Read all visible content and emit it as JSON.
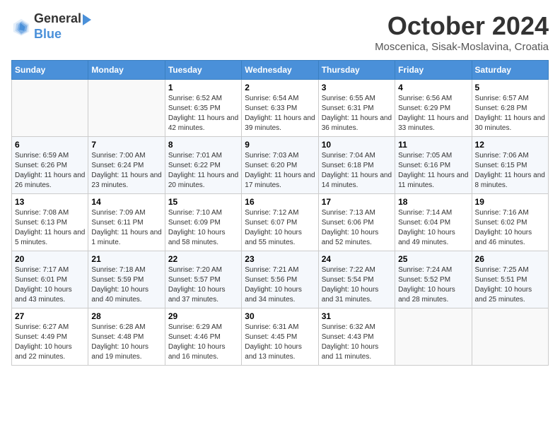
{
  "header": {
    "logo_general": "General",
    "logo_blue": "Blue",
    "title": "October 2024",
    "location": "Moscenica, Sisak-Moslavina, Croatia"
  },
  "days_of_week": [
    "Sunday",
    "Monday",
    "Tuesday",
    "Wednesday",
    "Thursday",
    "Friday",
    "Saturday"
  ],
  "weeks": [
    [
      {
        "day": "",
        "info": ""
      },
      {
        "day": "",
        "info": ""
      },
      {
        "day": "1",
        "info": "Sunrise: 6:52 AM\nSunset: 6:35 PM\nDaylight: 11 hours and 42 minutes."
      },
      {
        "day": "2",
        "info": "Sunrise: 6:54 AM\nSunset: 6:33 PM\nDaylight: 11 hours and 39 minutes."
      },
      {
        "day": "3",
        "info": "Sunrise: 6:55 AM\nSunset: 6:31 PM\nDaylight: 11 hours and 36 minutes."
      },
      {
        "day": "4",
        "info": "Sunrise: 6:56 AM\nSunset: 6:29 PM\nDaylight: 11 hours and 33 minutes."
      },
      {
        "day": "5",
        "info": "Sunrise: 6:57 AM\nSunset: 6:28 PM\nDaylight: 11 hours and 30 minutes."
      }
    ],
    [
      {
        "day": "6",
        "info": "Sunrise: 6:59 AM\nSunset: 6:26 PM\nDaylight: 11 hours and 26 minutes."
      },
      {
        "day": "7",
        "info": "Sunrise: 7:00 AM\nSunset: 6:24 PM\nDaylight: 11 hours and 23 minutes."
      },
      {
        "day": "8",
        "info": "Sunrise: 7:01 AM\nSunset: 6:22 PM\nDaylight: 11 hours and 20 minutes."
      },
      {
        "day": "9",
        "info": "Sunrise: 7:03 AM\nSunset: 6:20 PM\nDaylight: 11 hours and 17 minutes."
      },
      {
        "day": "10",
        "info": "Sunrise: 7:04 AM\nSunset: 6:18 PM\nDaylight: 11 hours and 14 minutes."
      },
      {
        "day": "11",
        "info": "Sunrise: 7:05 AM\nSunset: 6:16 PM\nDaylight: 11 hours and 11 minutes."
      },
      {
        "day": "12",
        "info": "Sunrise: 7:06 AM\nSunset: 6:15 PM\nDaylight: 11 hours and 8 minutes."
      }
    ],
    [
      {
        "day": "13",
        "info": "Sunrise: 7:08 AM\nSunset: 6:13 PM\nDaylight: 11 hours and 5 minutes."
      },
      {
        "day": "14",
        "info": "Sunrise: 7:09 AM\nSunset: 6:11 PM\nDaylight: 11 hours and 1 minute."
      },
      {
        "day": "15",
        "info": "Sunrise: 7:10 AM\nSunset: 6:09 PM\nDaylight: 10 hours and 58 minutes."
      },
      {
        "day": "16",
        "info": "Sunrise: 7:12 AM\nSunset: 6:07 PM\nDaylight: 10 hours and 55 minutes."
      },
      {
        "day": "17",
        "info": "Sunrise: 7:13 AM\nSunset: 6:06 PM\nDaylight: 10 hours and 52 minutes."
      },
      {
        "day": "18",
        "info": "Sunrise: 7:14 AM\nSunset: 6:04 PM\nDaylight: 10 hours and 49 minutes."
      },
      {
        "day": "19",
        "info": "Sunrise: 7:16 AM\nSunset: 6:02 PM\nDaylight: 10 hours and 46 minutes."
      }
    ],
    [
      {
        "day": "20",
        "info": "Sunrise: 7:17 AM\nSunset: 6:01 PM\nDaylight: 10 hours and 43 minutes."
      },
      {
        "day": "21",
        "info": "Sunrise: 7:18 AM\nSunset: 5:59 PM\nDaylight: 10 hours and 40 minutes."
      },
      {
        "day": "22",
        "info": "Sunrise: 7:20 AM\nSunset: 5:57 PM\nDaylight: 10 hours and 37 minutes."
      },
      {
        "day": "23",
        "info": "Sunrise: 7:21 AM\nSunset: 5:56 PM\nDaylight: 10 hours and 34 minutes."
      },
      {
        "day": "24",
        "info": "Sunrise: 7:22 AM\nSunset: 5:54 PM\nDaylight: 10 hours and 31 minutes."
      },
      {
        "day": "25",
        "info": "Sunrise: 7:24 AM\nSunset: 5:52 PM\nDaylight: 10 hours and 28 minutes."
      },
      {
        "day": "26",
        "info": "Sunrise: 7:25 AM\nSunset: 5:51 PM\nDaylight: 10 hours and 25 minutes."
      }
    ],
    [
      {
        "day": "27",
        "info": "Sunrise: 6:27 AM\nSunset: 4:49 PM\nDaylight: 10 hours and 22 minutes."
      },
      {
        "day": "28",
        "info": "Sunrise: 6:28 AM\nSunset: 4:48 PM\nDaylight: 10 hours and 19 minutes."
      },
      {
        "day": "29",
        "info": "Sunrise: 6:29 AM\nSunset: 4:46 PM\nDaylight: 10 hours and 16 minutes."
      },
      {
        "day": "30",
        "info": "Sunrise: 6:31 AM\nSunset: 4:45 PM\nDaylight: 10 hours and 13 minutes."
      },
      {
        "day": "31",
        "info": "Sunrise: 6:32 AM\nSunset: 4:43 PM\nDaylight: 10 hours and 11 minutes."
      },
      {
        "day": "",
        "info": ""
      },
      {
        "day": "",
        "info": ""
      }
    ]
  ]
}
